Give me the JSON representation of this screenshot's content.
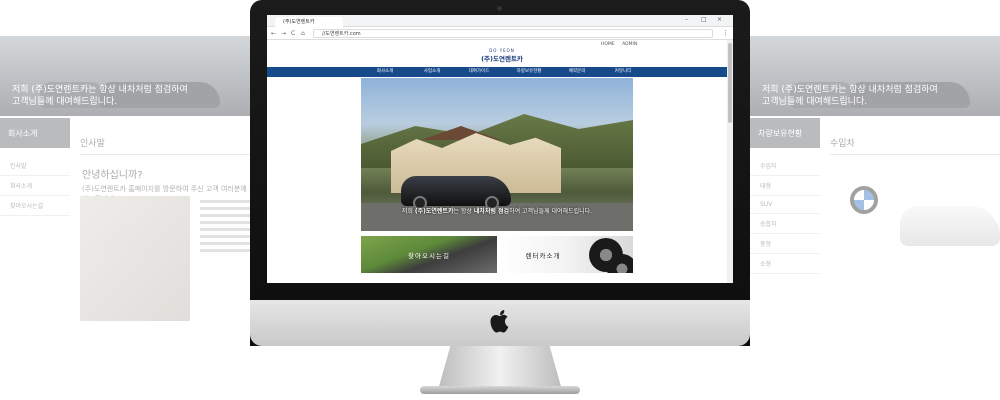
{
  "background_left": {
    "caption_line1": "저희 (주)도연렌트카는 항상 내차처럼 점검하여",
    "caption_line2": "고객님들께 대여해드립니다.",
    "side_title": "회사소개",
    "menu": [
      "인사말",
      "회사소개",
      "찾아오시는길"
    ],
    "section_title": "인사말",
    "greeting": "안녕하십니까?",
    "intro": "(주)도연렌트카 홈페이지를 방문하여 주신 고객 여러분께 감사드립니다"
  },
  "background_right": {
    "caption_line1": "저희 (주)도연렌트카는 항상 내차처럼 점검하여",
    "caption_line2": "고객님들께 대여해드립니다.",
    "side_title": "차량보유현황",
    "menu": [
      "수입차",
      "대형",
      "SUV",
      "승합차",
      "중형",
      "소형"
    ],
    "section_title": "수입차"
  },
  "browser": {
    "tab_title": "(주)도연렌트카",
    "url": "//도연렌트카.com",
    "window_controls": [
      "–",
      "□",
      "×"
    ],
    "nav": [
      "←",
      "→",
      "C",
      "⌂"
    ]
  },
  "site": {
    "top_links": [
      "HOME",
      "ADMIN"
    ],
    "logo_mark": "DO YEON",
    "logo_name": "(주)도연렌트카",
    "nav_items": [
      "회사소개",
      "사업소개",
      "대여가이드",
      "차량보유현황",
      "예약문의",
      "커뮤니티"
    ],
    "hero_caption_pre": "저희 ",
    "hero_caption_brand": "(주)도연렌트카",
    "hero_caption_mid": "는 항상 ",
    "hero_caption_strong": "내차처럼 점검",
    "hero_caption_post": "하여 고객님들께 대여해드립니다.",
    "banners": [
      "찾아오시는길",
      "렌터카소개"
    ]
  },
  "colors": {
    "nav_bg": "#164a8a",
    "logo": "#1a3c7a",
    "monitor_bezel": "#111111",
    "monitor_chin": "#d6d6d6"
  },
  "icons": [
    "apple-logo-icon",
    "back-icon",
    "forward-icon",
    "reload-icon",
    "home-icon",
    "bmw-logo-icon"
  ]
}
